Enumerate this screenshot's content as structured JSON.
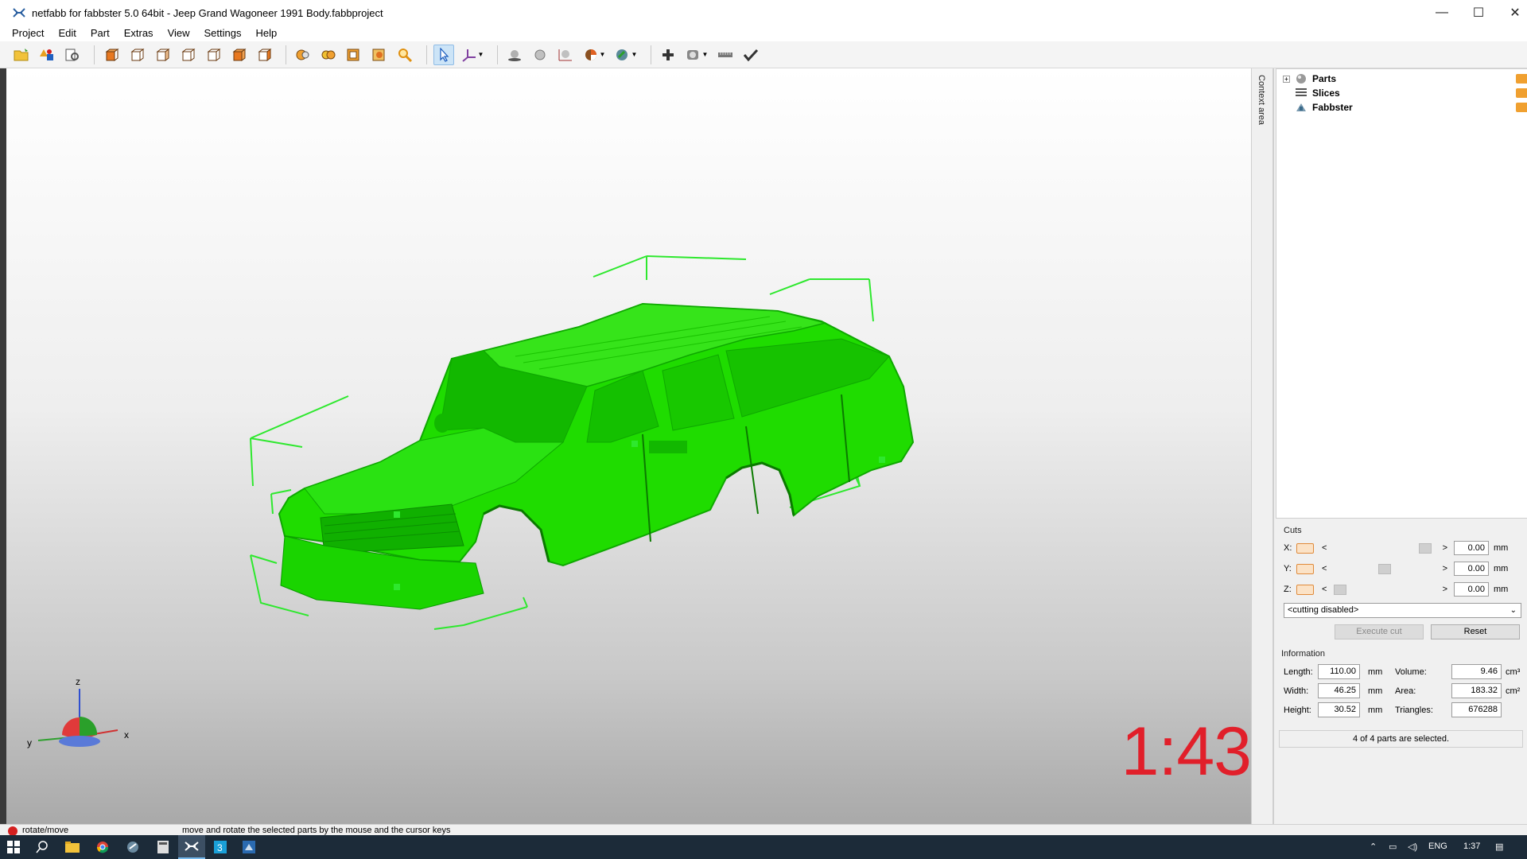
{
  "window": {
    "title": "netfabb for fabbster 5.0 64bit - Jeep Grand Wagoneer 1991 Body.fabbproject",
    "minimize": "—",
    "maximize": "☐",
    "close": "✕"
  },
  "menu": [
    "Project",
    "Edit",
    "Part",
    "Extras",
    "View",
    "Settings",
    "Help"
  ],
  "viewport": {
    "scale_label": "1:43",
    "model_color": "#1fdc00",
    "bbox_color": "#2ee82e",
    "axes": {
      "x": "x",
      "y": "y",
      "z": "z"
    }
  },
  "context_tab": "Context area",
  "tree": [
    {
      "label": "Parts",
      "icon": "parts-icon",
      "expandable": true
    },
    {
      "label": "Slices",
      "icon": "slices-icon",
      "expandable": false
    },
    {
      "label": "Fabbster",
      "icon": "fabbster-icon",
      "expandable": false
    }
  ],
  "cuts": {
    "title": "Cuts",
    "axes": [
      {
        "label": "X:",
        "value": "0.00",
        "unit": "mm",
        "thumb": 0.92
      },
      {
        "label": "Y:",
        "value": "0.00",
        "unit": "mm",
        "thumb": 0.5
      },
      {
        "label": "Z:",
        "value": "0.00",
        "unit": "mm",
        "thumb": 0.04
      }
    ],
    "slider_left": "<",
    "slider_right": ">",
    "mode": "<cutting disabled>",
    "execute_label": "Execute cut",
    "reset_label": "Reset"
  },
  "information": {
    "title": "Information",
    "length_label": "Length:",
    "length": "110.00",
    "length_unit": "mm",
    "width_label": "Width:",
    "width": "46.25",
    "width_unit": "mm",
    "height_label": "Height:",
    "height": "30.52",
    "height_unit": "mm",
    "volume_label": "Volume:",
    "volume": "9.46",
    "volume_unit": "cm³",
    "area_label": "Area:",
    "area": "183.32",
    "area_unit": "cm²",
    "triangles_label": "Triangles:",
    "triangles": "676288",
    "selection_status": "4 of 4 parts are selected."
  },
  "statusbar": {
    "mode": "rotate/move",
    "hint": "move and rotate the selected parts by the mouse and the cursor keys"
  },
  "taskbar": {
    "language": "ENG",
    "time": "1:37"
  }
}
